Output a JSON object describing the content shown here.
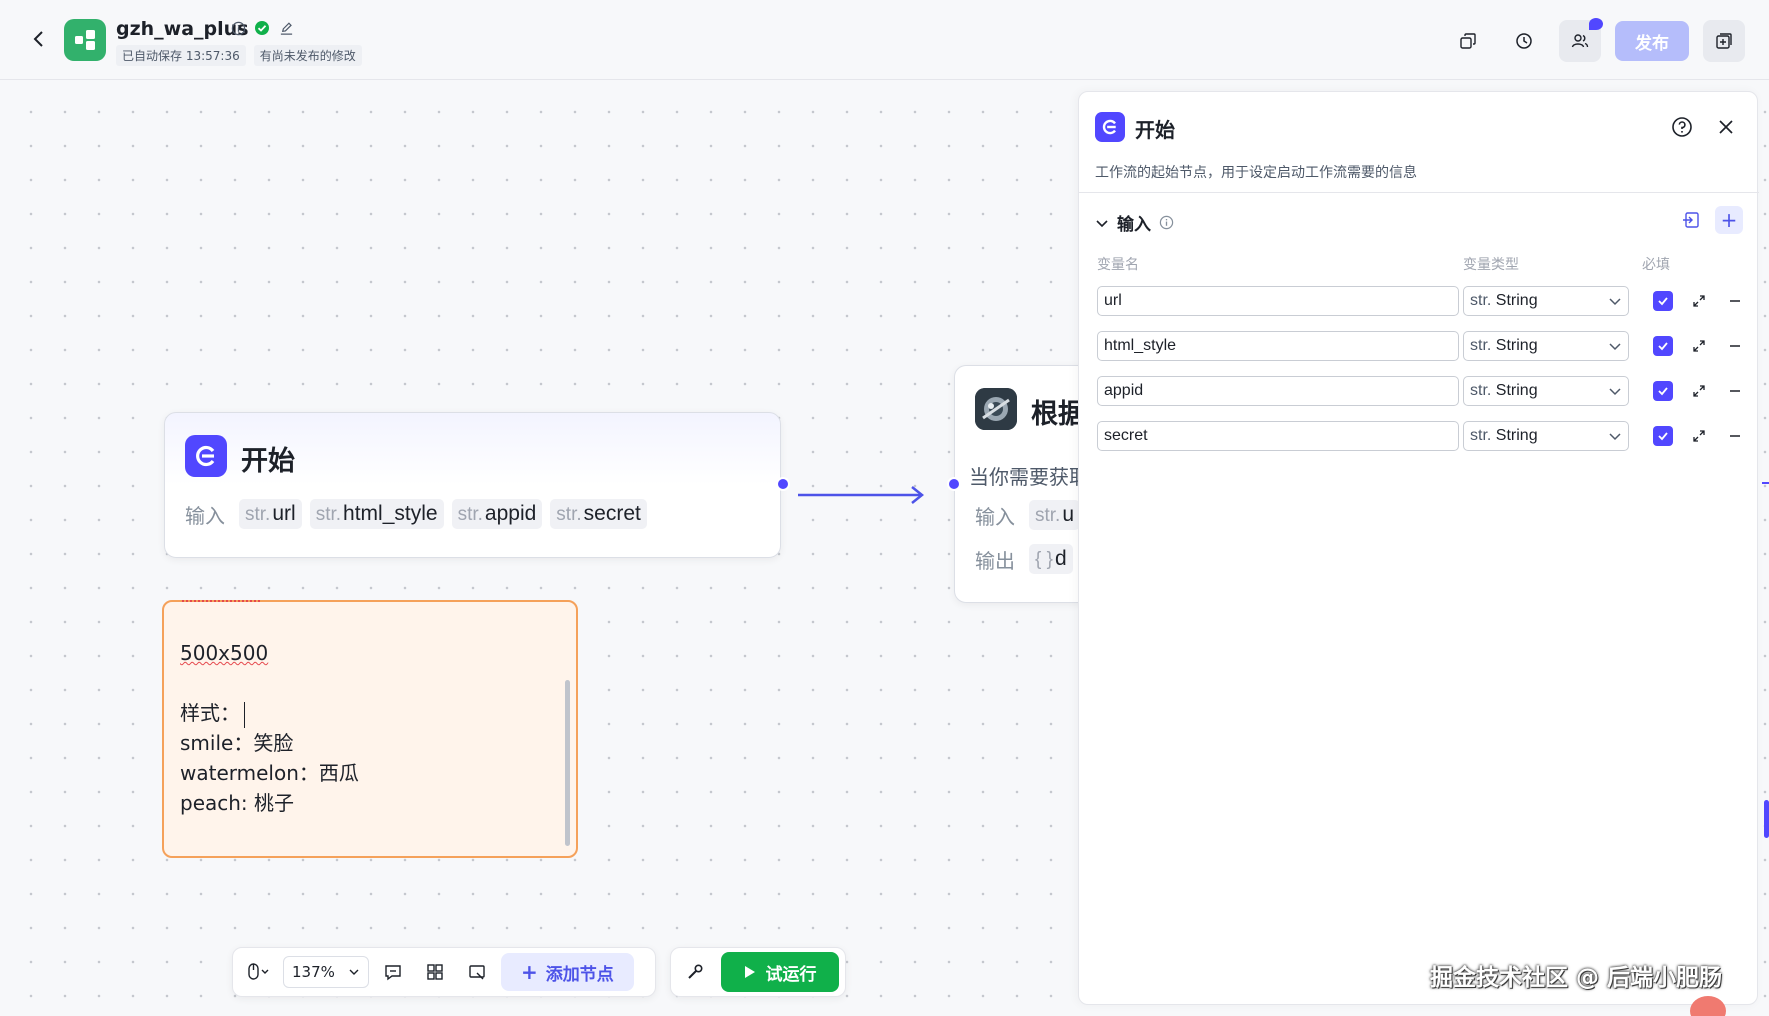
{
  "header": {
    "app_title": "gzh_wa_plus",
    "autosave": "已自动保存 13:57:36",
    "unpublished": "有尚未发布的修改",
    "publish_label": "发布",
    "logo_color": "#32b16c"
  },
  "canvas": {
    "start_node": {
      "title": "开始",
      "input_label": "输入",
      "params": [
        {
          "type": "str.",
          "name": "url"
        },
        {
          "type": "str.",
          "name": "html_style"
        },
        {
          "type": "str.",
          "name": "appid"
        },
        {
          "type": "str.",
          "name": "secret"
        }
      ]
    },
    "llm_node": {
      "title": "根据",
      "desc": "当你需要获取",
      "input_label": "输入",
      "input_type": "str.",
      "input_name": "u",
      "output_label": "输出",
      "output_type": "{ }",
      "output_name": "d"
    },
    "note": {
      "lines": [
        "500x500",
        "",
        "样式：",
        "smile：笑脸",
        "watermelon：西瓜",
        "peach: 桃子"
      ]
    }
  },
  "toolbar": {
    "zoom": "137%",
    "add_node_label": "添加节点",
    "run_label": "试运行"
  },
  "panel": {
    "title": "开始",
    "description": "工作流的起始节点，用于设定启动工作流需要的信息",
    "section_title": "输入",
    "col_name": "变量名",
    "col_type": "变量类型",
    "col_required": "必填",
    "variables": [
      {
        "name": "url",
        "type_prefix": "str.",
        "type": "String"
      },
      {
        "name": "html_style",
        "type_prefix": "str.",
        "type": "String"
      },
      {
        "name": "appid",
        "type_prefix": "str.",
        "type": "String"
      },
      {
        "name": "secret",
        "type_prefix": "str.",
        "type": "String"
      }
    ]
  },
  "watermark": "掘金技术社区 @ 后端小肥肠",
  "colors": {
    "accent": "#5147ff",
    "run_green": "#10b04a",
    "note_border": "#f5a15a"
  }
}
